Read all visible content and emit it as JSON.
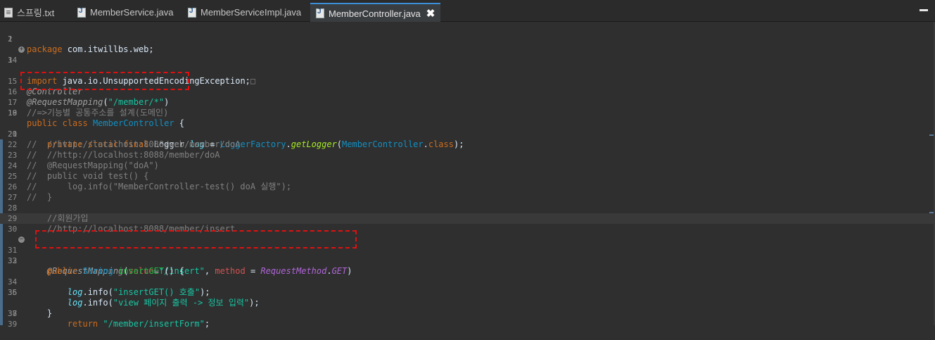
{
  "tabs": [
    {
      "label": "스프링.txt",
      "type": "txt",
      "active": false
    },
    {
      "label": "MemberService.java",
      "type": "java",
      "active": false
    },
    {
      "label": "MemberServiceImpl.java",
      "type": "java",
      "active": false
    },
    {
      "label": "MemberController.java",
      "type": "java",
      "active": true
    }
  ],
  "close_symbol": "✖",
  "fold_symbol": "+",
  "collapsed_marker": "□",
  "lines": {
    "l1": {
      "n": "1",
      "t": [
        "package",
        " com.itwillbs.web;"
      ]
    },
    "l2": {
      "n": "2"
    },
    "l3": {
      "n": "3",
      "t": [
        "import",
        " java.io.UnsupportedEncodingException;"
      ]
    },
    "l4": {
      "n": "14"
    },
    "l5": {
      "n": "15",
      "t": [
        "@Controller"
      ]
    },
    "l6": {
      "n": "16",
      "t": [
        "@RequestMapping",
        "(",
        "\"/member/*\"",
        ")"
      ]
    },
    "l7": {
      "n": "17",
      "t": [
        "//=>기능별 공통주소를 설계(도메인)"
      ]
    },
    "l8": {
      "n": "18",
      "t": [
        "public",
        " ",
        "class",
        " ",
        "MemberController",
        " {"
      ]
    },
    "l9": {
      "n": "19"
    },
    "l10": {
      "n": "20",
      "t": [
        "    ",
        "private",
        " ",
        "static",
        " ",
        "final",
        " Logger ",
        "log",
        " = ",
        "LoggerFactory",
        ".",
        "getLogger",
        "(",
        "MemberController",
        ".",
        "class",
        ");"
      ]
    },
    "l11": {
      "n": "21"
    },
    "l12": {
      "n": "22",
      "t": [
        "//  //http://localhost:8088/web/member/doA"
      ]
    },
    "l13": {
      "n": "23",
      "t": [
        "//  //http://localhost:8088/member/doA"
      ]
    },
    "l14": {
      "n": "24",
      "t": [
        "//  @RequestMapping(\"doA\")"
      ]
    },
    "l15": {
      "n": "25",
      "t": [
        "//  public void test() {"
      ]
    },
    "l16": {
      "n": "26",
      "t": [
        "//      log.info(\"MemberController-test() doA 실행\");"
      ]
    },
    "l17": {
      "n": "27",
      "t": [
        "//  }"
      ]
    },
    "l18": {
      "n": "28"
    },
    "l19": {
      "n": "29",
      "t": [
        "    //회원가입"
      ]
    },
    "l20": {
      "n": "30",
      "t": [
        "    //http://localhost:8088/member/insert"
      ]
    },
    "l21": {
      "n": "31",
      "t": [
        "    ",
        "@RequestMapping",
        "(",
        "value",
        "=",
        "\"/insert\"",
        ", ",
        "method",
        " = ",
        "RequestMethod",
        ".",
        "GET",
        ")"
      ]
    },
    "l22": {
      "n": "32",
      "t": [
        "    ",
        "public",
        " ",
        "String",
        " ",
        "insertGET",
        "() {"
      ]
    },
    "l23": {
      "n": "33"
    },
    "l24": {
      "n": "34",
      "t": [
        "        ",
        "log",
        ".info(",
        "\"insertGET() 호출\"",
        ");"
      ]
    },
    "l25": {
      "n": "35",
      "t": [
        "        ",
        "log",
        ".info(",
        "\"view 페이지 출력 -> 정보 입력\"",
        ");"
      ]
    },
    "l26": {
      "n": "36"
    },
    "l27": {
      "n": "37",
      "t": [
        "        ",
        "return",
        " ",
        "\"/member/insertForm\"",
        ";"
      ]
    },
    "l28": {
      "n": "38",
      "t": [
        "    }"
      ]
    },
    "l29": {
      "n": "39"
    }
  }
}
